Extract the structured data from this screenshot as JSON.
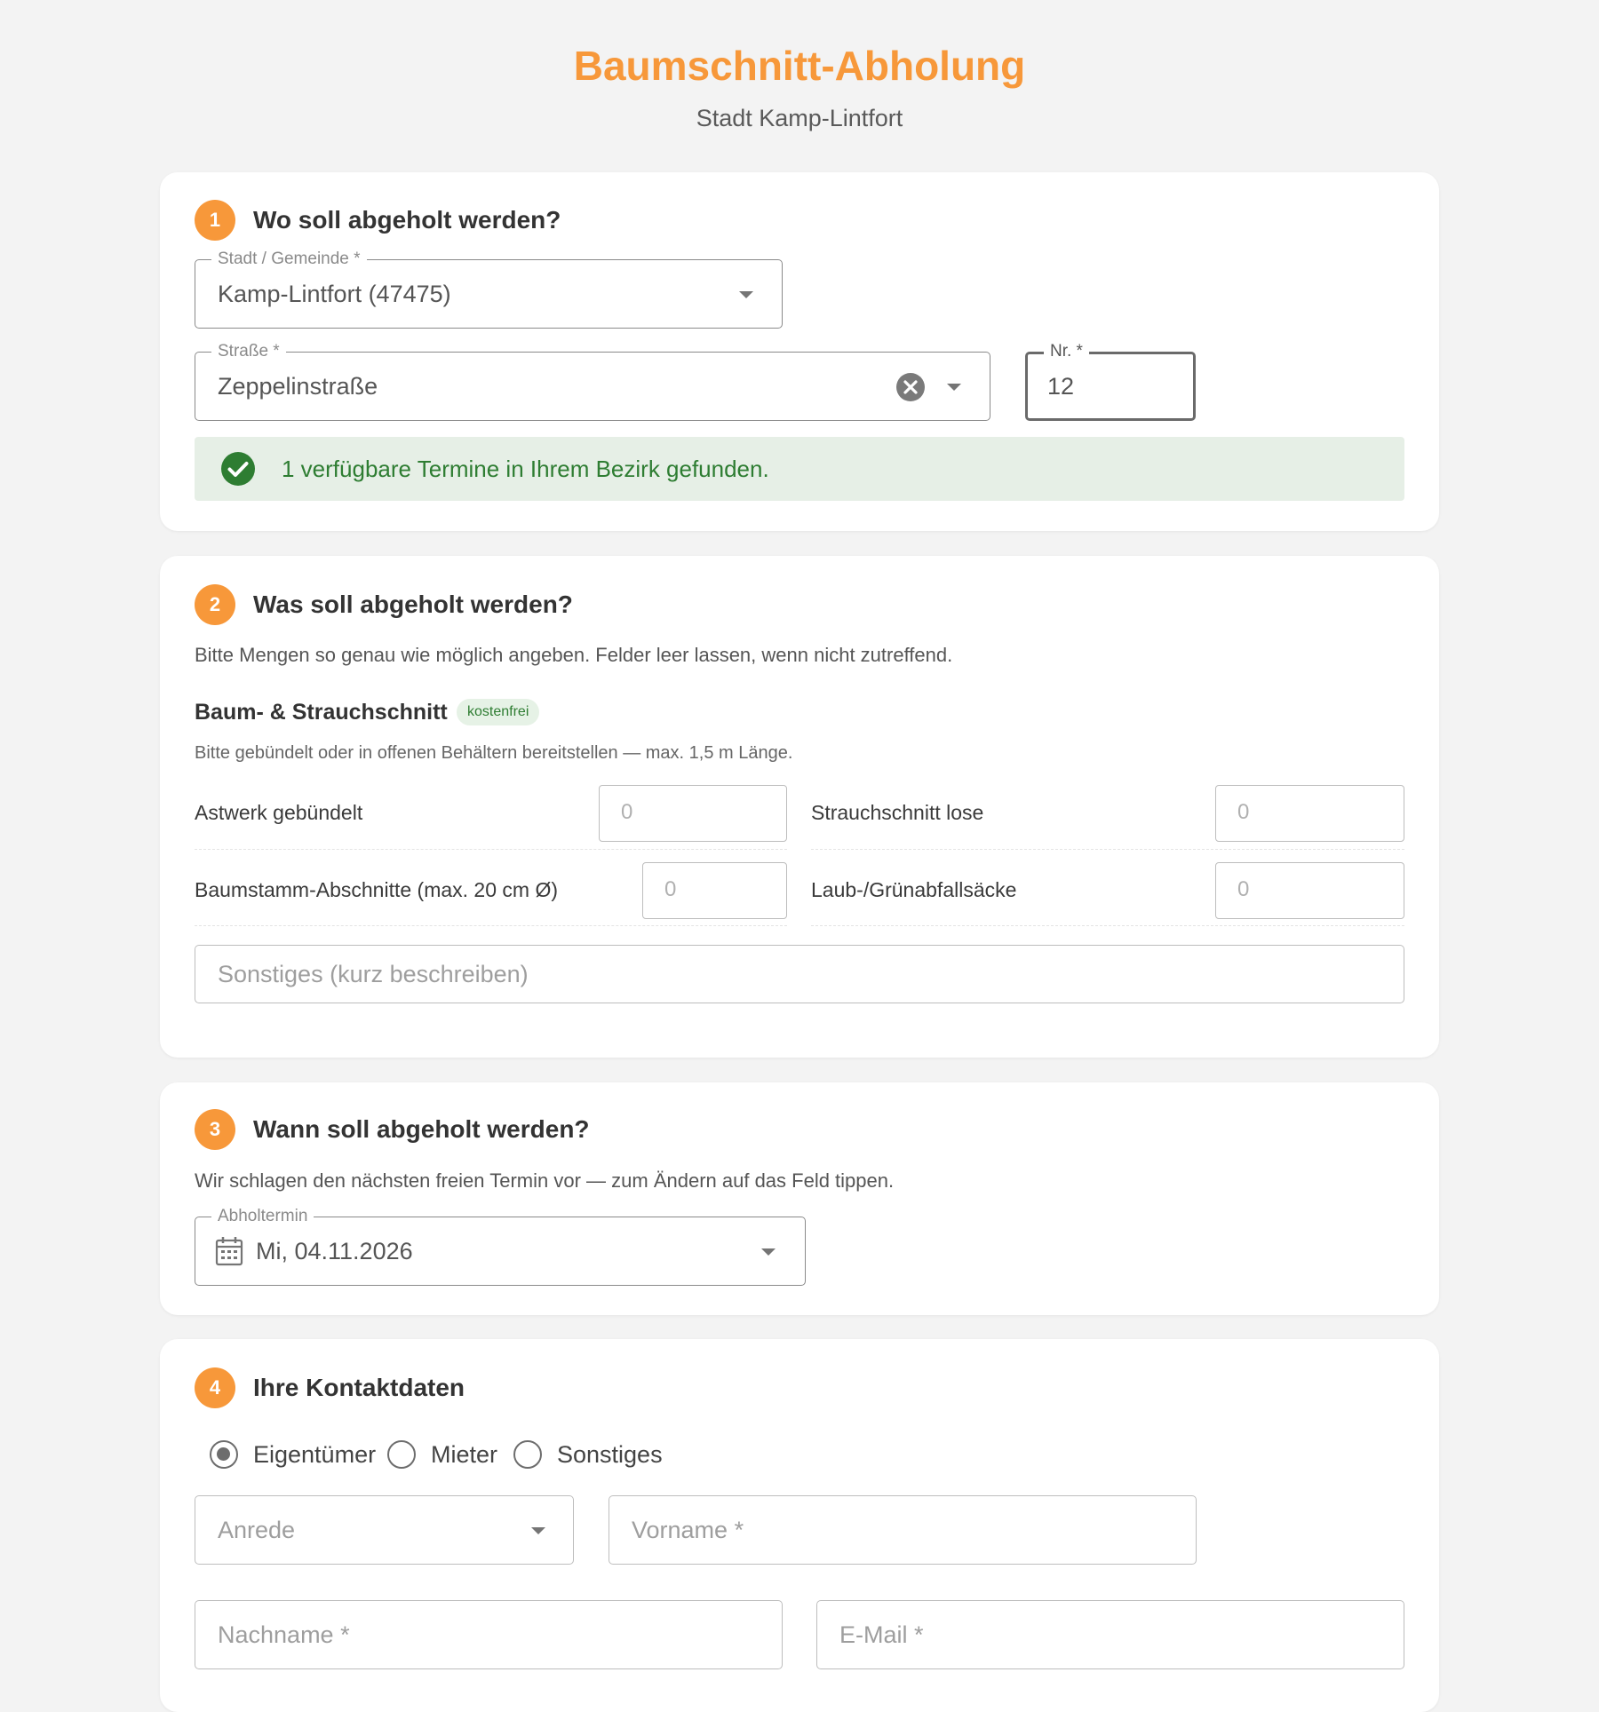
{
  "header": {
    "title": "Baumschnitt-Abholung",
    "subtitle": "Stadt Kamp-Lintfort"
  },
  "step1": {
    "number": "1",
    "title": "Wo soll abgeholt werden?",
    "city": {
      "label": "Stadt / Gemeinde *",
      "value": "Kamp-Lintfort (47475)"
    },
    "street": {
      "label": "Straße *",
      "value": "Zeppelinstraße"
    },
    "house_number": {
      "label": "Nr. *",
      "value": "12"
    },
    "alert": "1 verfügbare Termine in Ihrem Bezirk gefunden."
  },
  "step2": {
    "number": "2",
    "title": "Was soll abgeholt werden?",
    "intro": "Bitte Mengen so genau wie möglich angeben. Felder leer lassen, wenn nicht zutreffend.",
    "group_title": "Baum- & Strauchschnitt",
    "group_badge": "kostenfrei",
    "group_hint": "Bitte gebündelt oder in offenen Behältern bereitstellen — max. 1,5 m Länge.",
    "items": [
      {
        "label": "Astwerk gebündelt",
        "placeholder": "0"
      },
      {
        "label": "Strauchschnitt lose",
        "placeholder": "0"
      },
      {
        "label": "Baumstamm-Abschnitte (max. 20 cm Ø)",
        "placeholder": "0"
      },
      {
        "label": "Laub-/Grünabfallsäcke",
        "placeholder": "0"
      }
    ],
    "other_placeholder": "Sonstiges (kurz beschreiben)"
  },
  "step3": {
    "number": "3",
    "title": "Wann soll abgeholt werden?",
    "intro": "Wir schlagen den nächsten freien Termin vor — zum Ändern auf das Feld tippen.",
    "date": {
      "label": "Abholtermin",
      "value": "Mi, 04.11.2026"
    }
  },
  "step4": {
    "number": "4",
    "title": "Ihre Kontaktdaten",
    "roles": [
      {
        "label": "Eigentümer",
        "selected": true
      },
      {
        "label": "Mieter",
        "selected": false
      },
      {
        "label": "Sonstiges",
        "selected": false
      }
    ],
    "salutation_placeholder": "Anrede",
    "firstname_placeholder": "Vorname *",
    "lastname_placeholder": "Nachname *",
    "email_placeholder": "E-Mail *"
  },
  "colors": {
    "accent": "#f7983a",
    "success_text": "#2e7d32",
    "success_bg": "#e6efe6",
    "success_icon": "#2e7d32"
  },
  "icons": {
    "clear": "clear-circle-icon",
    "dropdown": "caret-down-icon",
    "success": "check-circle-icon",
    "calendar": "calendar-icon"
  }
}
